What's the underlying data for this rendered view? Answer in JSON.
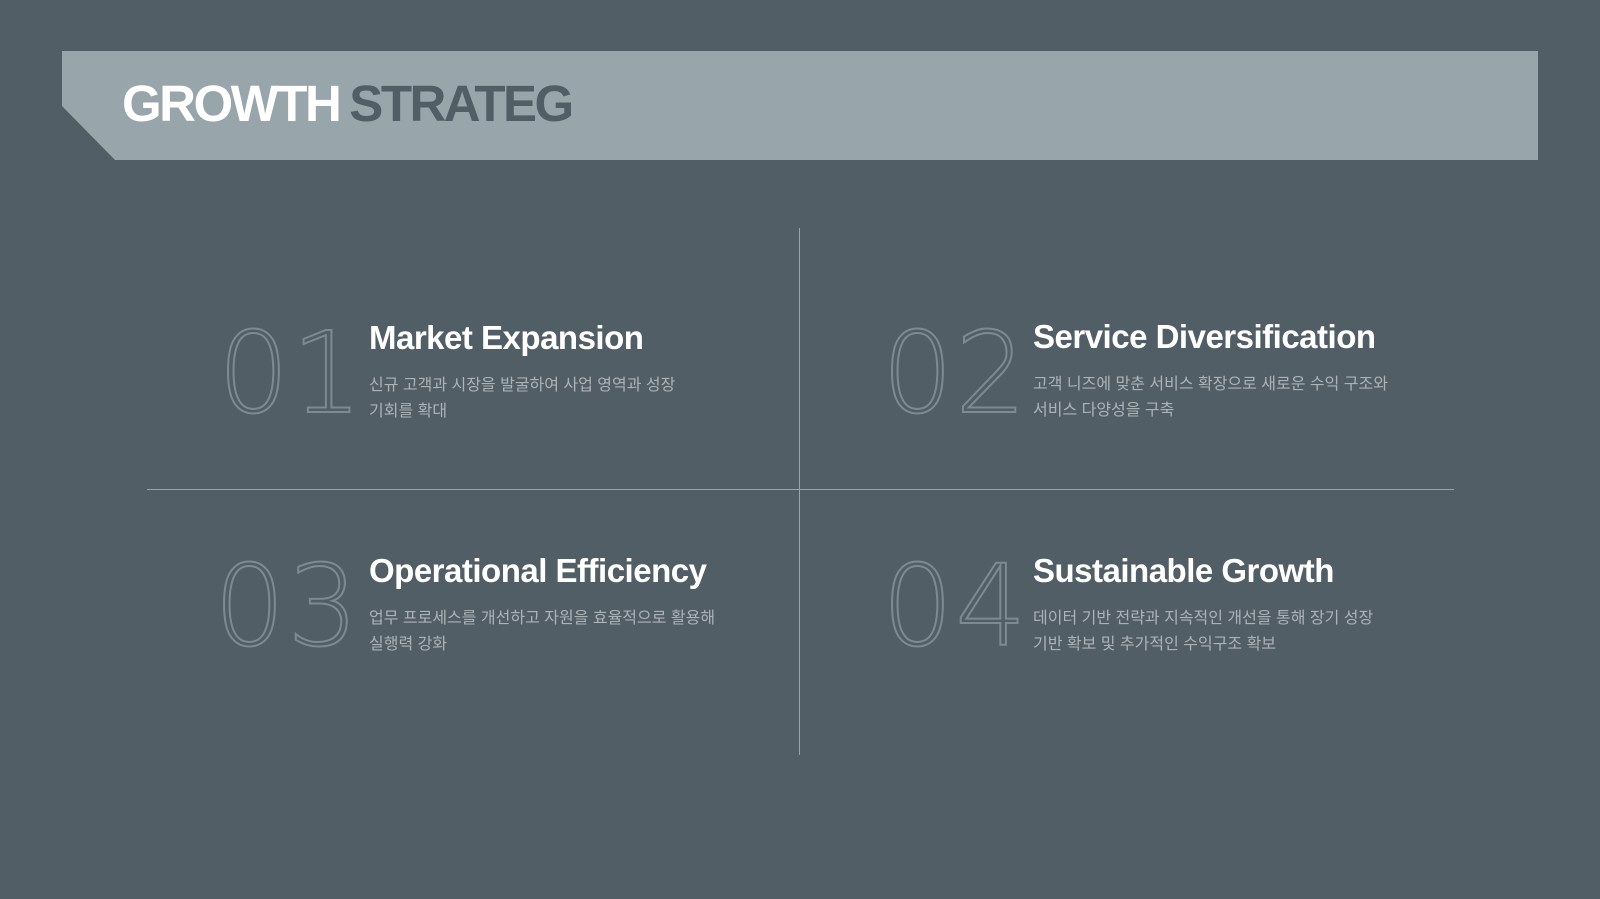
{
  "title": {
    "part1": "GROWTH",
    "part2": "STRATEG"
  },
  "items": [
    {
      "number": "01",
      "title": "Market Expansion",
      "desc_line1": "신규 고객과 시장을 발굴하여 사업 영역과 성장",
      "desc_line2": "기회를 확대"
    },
    {
      "number": "02",
      "title": "Service Diversification",
      "desc_line1": "고객 니즈에 맞춘 서비스 확장으로 새로운 수익 구조와",
      "desc_line2": "서비스 다양성을 구축"
    },
    {
      "number": "03",
      "title": "Operational Efficiency",
      "desc_line1": "업무 프로세스를 개선하고 자원을 효율적으로 활용해",
      "desc_line2": "실행력 강화"
    },
    {
      "number": "04",
      "title": "Sustainable Growth",
      "desc_line1": "데이터 기반 전략과 지속적인 개선을 통해 장기 성장",
      "desc_line2": "기반 확보 및 추가적인 수익구조 확보"
    }
  ]
}
